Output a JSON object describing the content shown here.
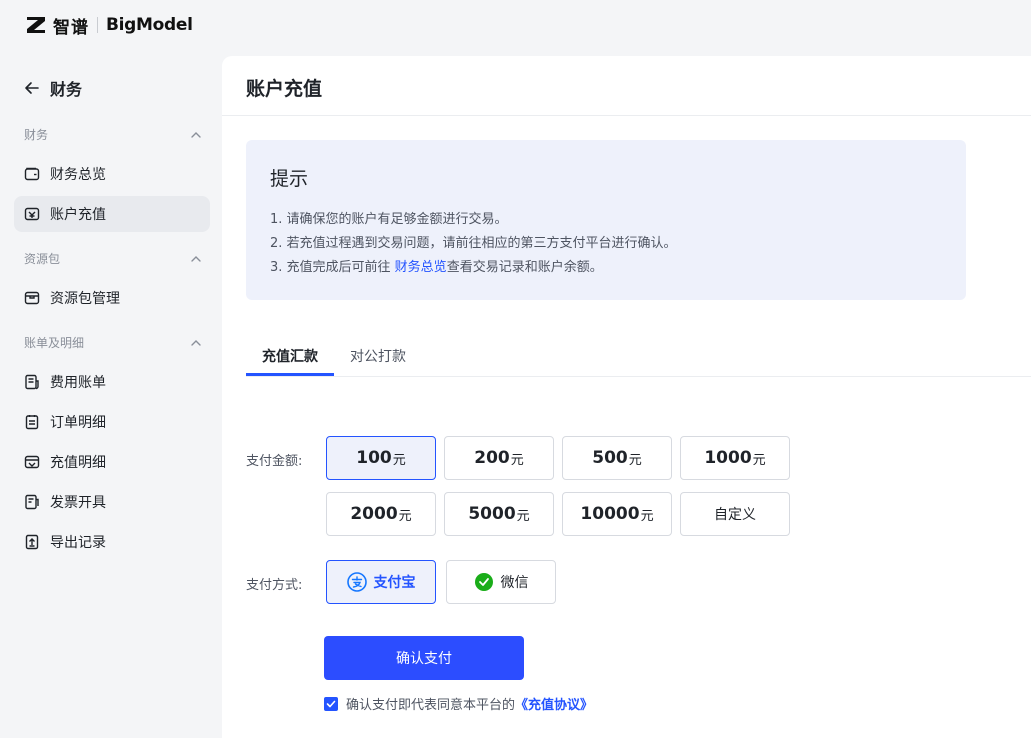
{
  "brand": {
    "cn": "智谱",
    "en": "BigModel"
  },
  "sidebar": {
    "back_label": "财务",
    "groups": [
      {
        "title": "财务",
        "items": [
          {
            "label": "财务总览",
            "icon": "wallet-icon"
          },
          {
            "label": "账户充值",
            "icon": "recharge-icon",
            "active": true
          }
        ]
      },
      {
        "title": "资源包",
        "items": [
          {
            "label": "资源包管理",
            "icon": "package-icon"
          }
        ]
      },
      {
        "title": "账单及明细",
        "items": [
          {
            "label": "费用账单",
            "icon": "bill-icon"
          },
          {
            "label": "订单明细",
            "icon": "order-icon"
          },
          {
            "label": "充值明细",
            "icon": "recharge-detail-icon"
          },
          {
            "label": "发票开具",
            "icon": "invoice-icon"
          },
          {
            "label": "导出记录",
            "icon": "export-icon"
          }
        ]
      }
    ]
  },
  "main": {
    "title": "账户充值",
    "notice": {
      "title": "提示",
      "line1": "1. 请确保您的账户有足够金额进行交易。",
      "line2": "2. 若充值过程遇到交易问题，请前往相应的第三方支付平台进行确认。",
      "line3_prefix": "3. 充值完成后可前往 ",
      "line3_link": "财务总览",
      "line3_suffix": "查看交易记录和账户余额。"
    },
    "tabs": [
      {
        "label": "充值汇款",
        "active": true
      },
      {
        "label": "对公打款"
      }
    ],
    "amount_label": "支付金额:",
    "amount_unit": "元",
    "amounts": [
      "100",
      "200",
      "500",
      "1000",
      "2000",
      "5000",
      "10000"
    ],
    "selected_amount": "100",
    "custom_label": "自定义",
    "method_label": "支付方式:",
    "methods": [
      {
        "label": "支付宝",
        "icon": "alipay-icon",
        "selected": true
      },
      {
        "label": "微信",
        "icon": "wechat-icon"
      }
    ],
    "confirm_label": "确认支付",
    "agreement_text": "确认支付即代表同意本平台的",
    "agreement_link": "《充值协议》",
    "agreement_checked": true
  },
  "colors": {
    "accent": "#2454ff",
    "selected_bg": "#eef1fb",
    "wechat": "#1aad19",
    "alipay": "#1677ff"
  }
}
